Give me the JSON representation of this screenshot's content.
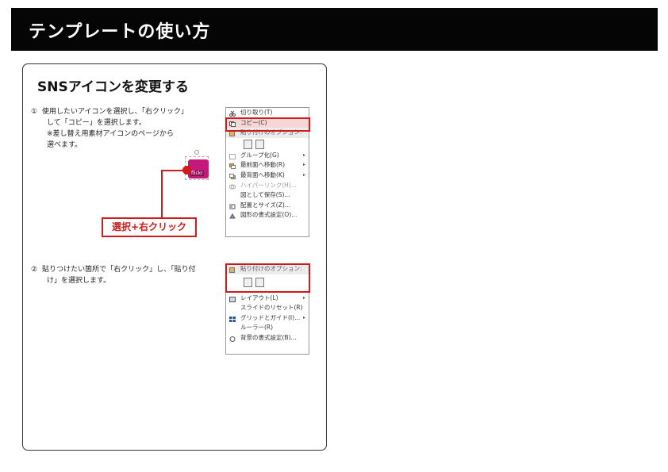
{
  "header": {
    "title": "テンプレートの使い方"
  },
  "section": {
    "title": "SNSアイコンを変更する"
  },
  "step1": {
    "num": "①",
    "line1": "使用したいアイコンを選択し、「右クリック」",
    "line2": "して「コピー」を選択します。",
    "line3": "※差し替え用素材アイコンのページから",
    "line4": "選べます。"
  },
  "step2": {
    "num": "②",
    "line1": "貼りつけたい箇所で「右クリック」し、「貼り付",
    "line2": "け」を選択します。"
  },
  "thumbnail": {
    "label": "flickr"
  },
  "callout": {
    "label": "選択+右クリック"
  },
  "menu1": {
    "items": [
      {
        "label": "切り取り(T)",
        "icon": "scissors-icon"
      },
      {
        "label": "コピー(C)",
        "icon": "copy-icon"
      },
      {
        "label": "貼り付けのオプション:",
        "icon": "paste-icon"
      },
      {
        "label": "グループ化(G)",
        "icon": "group-icon",
        "arrow": "▸"
      },
      {
        "label": "最前面へ移動(R)",
        "icon": "bring-front-icon",
        "arrow": "▸"
      },
      {
        "label": "最背面へ移動(K)",
        "icon": "send-back-icon",
        "arrow": "▸"
      },
      {
        "label": "ハイパーリンク(H)...",
        "icon": "hyperlink-icon"
      },
      {
        "label": "図として保存(S)...",
        "icon": ""
      },
      {
        "label": "配置とサイズ(Z)...",
        "icon": "size-icon"
      },
      {
        "label": "図形の書式設定(O)...",
        "icon": "format-icon"
      }
    ]
  },
  "menu2": {
    "items": [
      {
        "label": "貼り付けのオプション:",
        "icon": "paste-icon"
      },
      {
        "label": "レイアウト(L)",
        "icon": "layout-icon",
        "arrow": "▸"
      },
      {
        "label": "スライドのリセット(R)",
        "icon": ""
      },
      {
        "label": "グリッドとガイド(I)...",
        "icon": "grid-icon",
        "arrow": "▸"
      },
      {
        "label": "ルーラー(R)",
        "icon": ""
      },
      {
        "label": "背景の書式設定(B)...",
        "icon": "background-icon"
      }
    ]
  }
}
